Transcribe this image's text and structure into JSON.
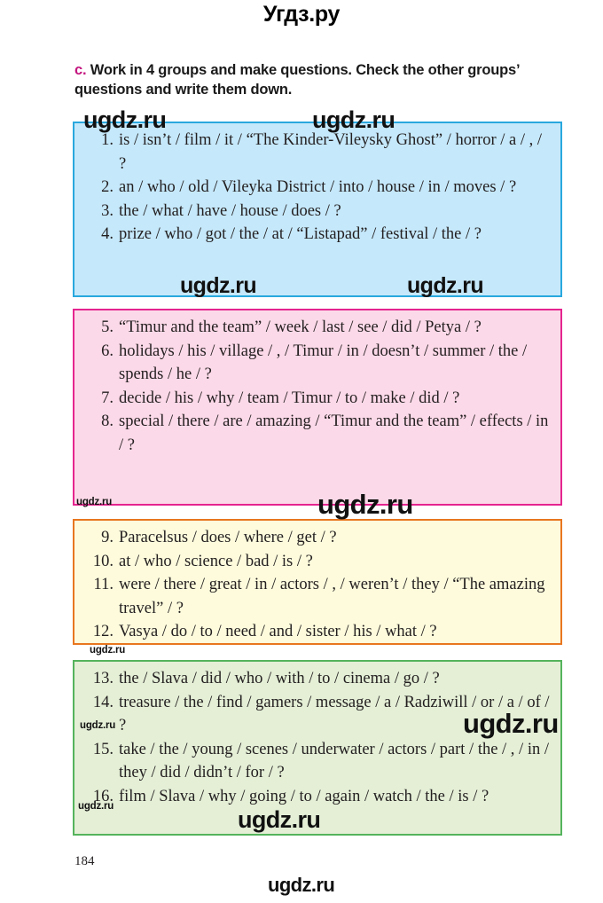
{
  "site": {
    "header_logo": "Угдз.ру",
    "footer_logo": "ugdz.ru",
    "watermark": "ugdz.ru"
  },
  "task": {
    "marker": "c.",
    "text": "Work in 4 groups and make questions. Check the other groups’ questions and write them down."
  },
  "colors": {
    "marker": "#c4167f",
    "blue_fill": "#c5e8fa",
    "blue_border": "#29a8de",
    "pink_fill": "#fcd9e8",
    "pink_border": "#e5248f",
    "yellow_fill": "#fdfbdc",
    "yellow_border": "#e8761f",
    "green_fill": "#e4efd6",
    "green_border": "#55b35c"
  },
  "groups": [
    {
      "color": "blue",
      "items": [
        {
          "num": "1.",
          "text": "is / isn’t / film / it / “The Kinder-Vileysky Ghost” / horror / a / , / ?"
        },
        {
          "num": "2.",
          "text": "an / who / old / Vileyka District / into / house / in / moves / ?"
        },
        {
          "num": "3.",
          "text": "the / what / have / house / does / ?"
        },
        {
          "num": "4.",
          "text": "prize / who / got / the / at / “Listapad” / festival / the / ?"
        }
      ]
    },
    {
      "color": "pink",
      "items": [
        {
          "num": "5.",
          "text": "“Timur and the team” / week / last / see / did / Petya / ?"
        },
        {
          "num": "6.",
          "text": "holidays / his / village / , / Timur / in / doesn’t / summer / the / spends / he / ?"
        },
        {
          "num": "7.",
          "text": "decide / his / why / team / Timur / to / make / did / ?"
        },
        {
          "num": "8.",
          "text": "special / there / are / amazing / “Timur and the team” / effects / in / ?"
        }
      ]
    },
    {
      "color": "yellow",
      "items": [
        {
          "num": "9.",
          "text": "Paracelsus / does / where / get / ?"
        },
        {
          "num": "10.",
          "text": "at / who / science / bad / is / ?"
        },
        {
          "num": "11.",
          "text": "were / there / great / in / actors / , / weren’t / they / “The amazing travel” / ?"
        },
        {
          "num": "12.",
          "text": "Vasya / do / to / need / and / sister / his / what / ?"
        }
      ]
    },
    {
      "color": "green",
      "items": [
        {
          "num": "13.",
          "text": "the / Slava / did / who / with / to / cinema / go / ?"
        },
        {
          "num": "14.",
          "text": "treasure / the / find / gamers / message / a / Radziwill / or / a / of / ?"
        },
        {
          "num": "15.",
          "text": "take / the / young / scenes / underwater / actors / part / the / , / in / they / did / didn’t / for / ?"
        },
        {
          "num": "16.",
          "text": "film / Slava / why / going / to / again / watch / the / is / ?"
        }
      ]
    }
  ],
  "page_number": "184"
}
